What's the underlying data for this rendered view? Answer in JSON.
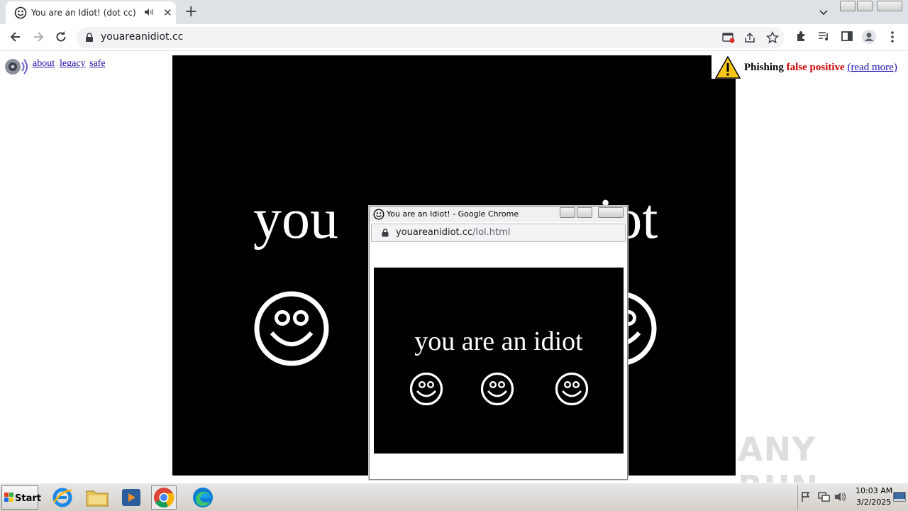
{
  "browser": {
    "tab_title": "You are an Idiot! (dot cc)",
    "tab_close": "✕",
    "new_tab": "+",
    "url": "youareanidiot.cc"
  },
  "page": {
    "links": [
      "about",
      "legacy",
      "safe"
    ],
    "video_words": {
      "left": "you",
      "right": "iot"
    },
    "warning": {
      "bold_text": "Phishing ",
      "red_text": "false positive",
      "link_text": "(read more)"
    }
  },
  "popup": {
    "title": "You are an Idiot! - Google Chrome",
    "url_host": "youareanidiot.cc",
    "url_path": "/lol.html",
    "video_text": "you are an idiot"
  },
  "taskbar": {
    "start_label": "Start",
    "time": "10:03 AM",
    "date": "3/2/2025"
  },
  "watermark": "ANY RUN",
  "colors": {
    "chrome_tab_strip": "#dee1e6",
    "warning_red": "#d00000",
    "link_blue": "#1a0dab"
  }
}
